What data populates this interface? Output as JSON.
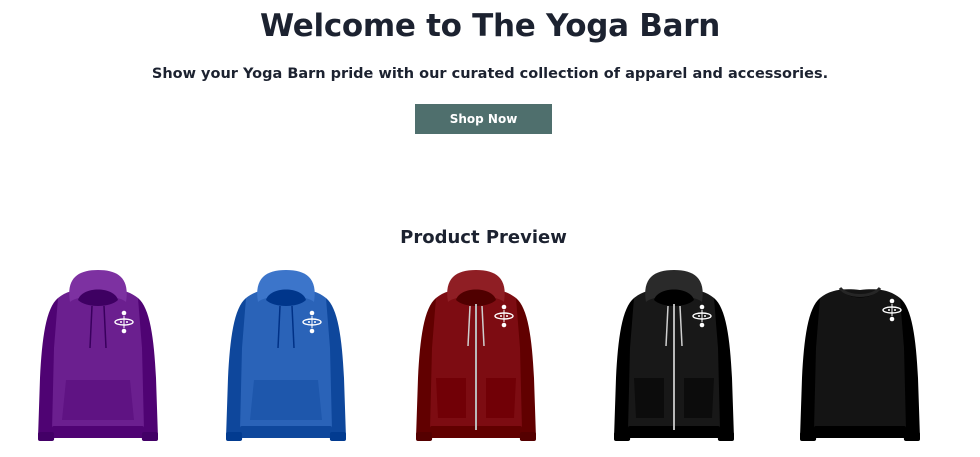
{
  "hero": {
    "title": "Welcome to The Yoga Barn",
    "subtitle": "Show your Yoga Barn pride with our curated collection of apparel and accessories.",
    "cta_label": "Shop Now",
    "cta_color": "#4f6f6d"
  },
  "preview": {
    "title": "Product Preview",
    "products": [
      {
        "type": "pullover-hoodie",
        "color": "#6b1f8f"
      },
      {
        "type": "pullover-hoodie",
        "color": "#2a63b8"
      },
      {
        "type": "zip-hoodie",
        "color": "#7d0c12"
      },
      {
        "type": "zip-hoodie",
        "color": "#181818"
      },
      {
        "type": "crewneck-sweatshirt",
        "color": "#141414"
      }
    ]
  }
}
